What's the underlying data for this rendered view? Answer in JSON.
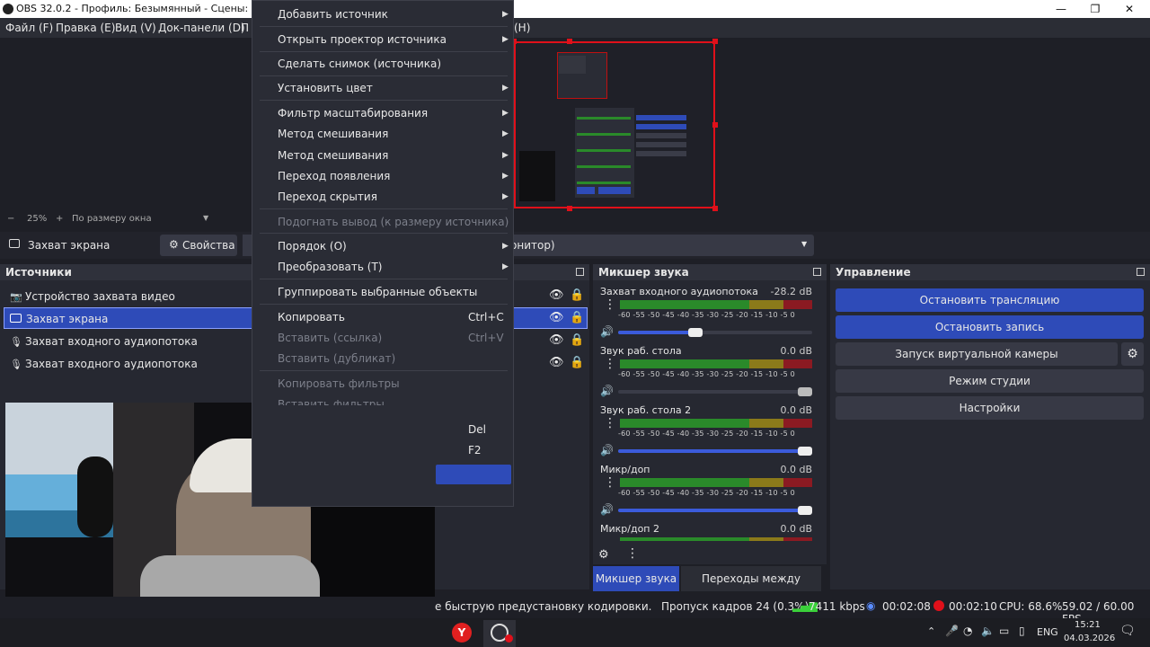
{
  "window": {
    "title": "OBS 32.0.2 - Профиль: Безымянный - Сцены: Безымянн",
    "minimize": "—",
    "maximize": "❐",
    "close": "✕"
  },
  "menubar": {
    "file": "Файл (F)",
    "edit": "Правка (E)",
    "view": "Вид (V)",
    "docks": "Док-панели (D)",
    "partial_left": "П",
    "partial_right": "(H)"
  },
  "zoom": {
    "minus": "−",
    "level": "25%",
    "plus": "+",
    "mode": "По размеру окна"
  },
  "propsbar": {
    "selected_source": "Захват экрана",
    "properties_label": "Свойства",
    "monitor_partial": "онитор)"
  },
  "sources": {
    "header": "Источники",
    "items": [
      {
        "label": "Устройство захвата видео",
        "icon": "camera-icon"
      },
      {
        "label": "Захват экрана",
        "icon": "monitor-icon"
      },
      {
        "label": "Захват входного аудиопотока",
        "icon": "microphone-icon"
      },
      {
        "label": "Захват входного аудиопотока",
        "icon": "microphone-icon"
      }
    ]
  },
  "context_menu": {
    "items": [
      {
        "label": "Добавить источник",
        "submenu": true,
        "disabled": false
      },
      {
        "label": "Открыть проектор источника",
        "submenu": true,
        "disabled": false
      },
      {
        "label": "Сделать снимок (источника)",
        "submenu": false,
        "disabled": false
      },
      {
        "label": "Установить цвет",
        "submenu": true,
        "disabled": false
      },
      {
        "label": "Фильтр масштабирования",
        "submenu": true,
        "disabled": false
      },
      {
        "label": "Метод смешивания",
        "submenu": true,
        "disabled": false
      },
      {
        "label": "Метод смешивания",
        "submenu": true,
        "disabled": false
      },
      {
        "label": "Переход появления",
        "submenu": true,
        "disabled": false
      },
      {
        "label": "Переход скрытия",
        "submenu": true,
        "disabled": false
      },
      {
        "label": "Подогнать вывод (к размеру источника)",
        "submenu": false,
        "disabled": true
      },
      {
        "label": "Порядок (O)",
        "submenu": true,
        "disabled": false
      },
      {
        "label": "Преобразовать (T)",
        "submenu": true,
        "disabled": false
      },
      {
        "label": "Группировать выбранные объекты",
        "submenu": false,
        "disabled": false
      },
      {
        "label": "Копировать",
        "shortcut": "Ctrl+C",
        "disabled": false
      },
      {
        "label": "Вставить (ссылка)",
        "shortcut": "Ctrl+V",
        "disabled": true
      },
      {
        "label": "Вставить (дубликат)",
        "disabled": true
      },
      {
        "label": "Копировать фильтры",
        "disabled": true
      },
      {
        "label": "Вставить фильтры",
        "disabled": true
      }
    ],
    "extra_shortcuts": [
      "Del",
      "F2"
    ]
  },
  "mixer": {
    "header": "Микшер звука",
    "ticks": "-60 -55 -50 -45 -40 -35 -30 -25 -20 -15 -10 -5 0",
    "channels": [
      {
        "name": "Захват входного аудиопотока",
        "db": "-28.2 dB",
        "volume": 0.4
      },
      {
        "name": "Звук раб. стола",
        "db": "0.0 dB",
        "volume": 1.0,
        "muted_style": true
      },
      {
        "name": "Звук раб. стола 2",
        "db": "0.0 dB",
        "volume": 1.0
      },
      {
        "name": "Микр/доп",
        "db": "0.0 dB",
        "volume": 1.0
      },
      {
        "name": "Микр/доп 2",
        "db": "0.0 dB",
        "volume": 1.0
      }
    ],
    "tab_mixer": "Микшер звука",
    "tab_transitions": "Переходы между сценами"
  },
  "controls": {
    "header": "Управление",
    "stop_stream": "Остановить трансляцию",
    "stop_record": "Остановить запись",
    "virtual_cam": "Запуск виртуальной камеры",
    "studio_mode": "Режим студии",
    "settings": "Настройки"
  },
  "statusbar": {
    "message": "е быструю предустановку кодировки.",
    "dropped": "Пропуск кадров 24 (0.3%)",
    "bitrate": "7411 kbps",
    "stream_time": "00:02:08",
    "rec_time": "00:02:10",
    "cpu": "CPU: 68.6%",
    "fps": "59.02 / 60.00 FPS"
  },
  "taskbar": {
    "lang": "ENG",
    "time": "15:21",
    "date": "04.03.2026"
  },
  "colors": {
    "accent": "#2e4bb8",
    "record_red": "#e0101a",
    "panel": "#262831"
  }
}
